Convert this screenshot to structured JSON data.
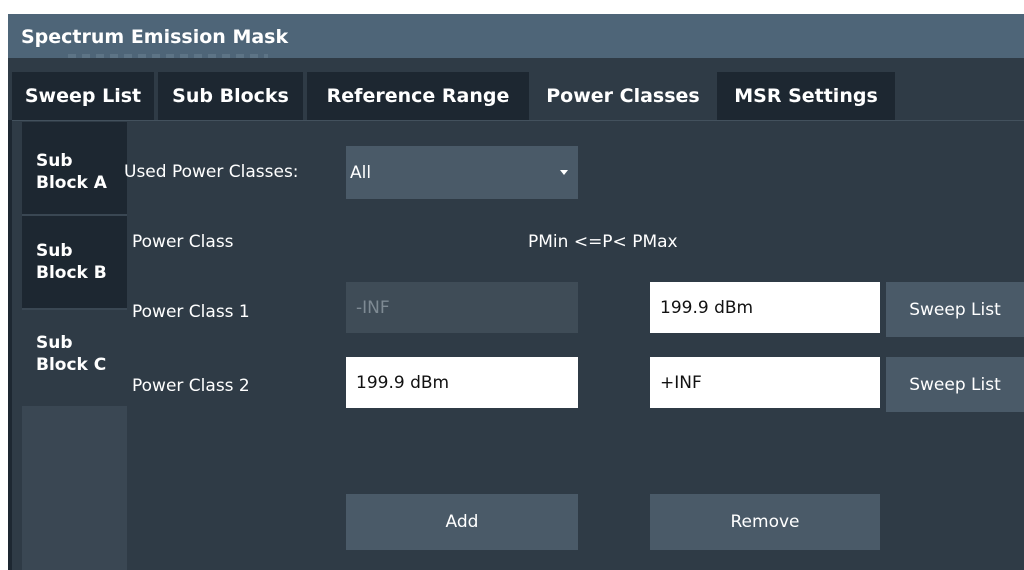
{
  "dialog": {
    "title": "Spectrum Emission Mask"
  },
  "tabs": [
    {
      "label": "Sweep List"
    },
    {
      "label": "Sub Blocks"
    },
    {
      "label": "Reference Range"
    },
    {
      "label": "Power Classes"
    },
    {
      "label": "MSR Settings"
    }
  ],
  "side_tabs": [
    {
      "line1": "Sub",
      "line2": "Block A"
    },
    {
      "line1": "Sub",
      "line2": "Block B"
    },
    {
      "line1": "Sub",
      "line2": "Block C"
    }
  ],
  "used_power_classes": {
    "label": "Used Power Classes:",
    "value": "All"
  },
  "headers": {
    "power_class": "Power Class",
    "range": "PMin <=P< PMax"
  },
  "rows": [
    {
      "label": "Power Class 1",
      "pmin": "-INF",
      "pmax": "199.9 dBm",
      "button": "Sweep List"
    },
    {
      "label": "Power Class 2",
      "pmin": "199.9 dBm",
      "pmax": "+INF",
      "button": "Sweep List"
    }
  ],
  "buttons": {
    "add": "Add",
    "remove": "Remove"
  },
  "colors": {
    "title_bar": "#4e6578",
    "background": "#2f3b46",
    "tab_inactive": "#1d2731",
    "button": "#4a5a68"
  }
}
